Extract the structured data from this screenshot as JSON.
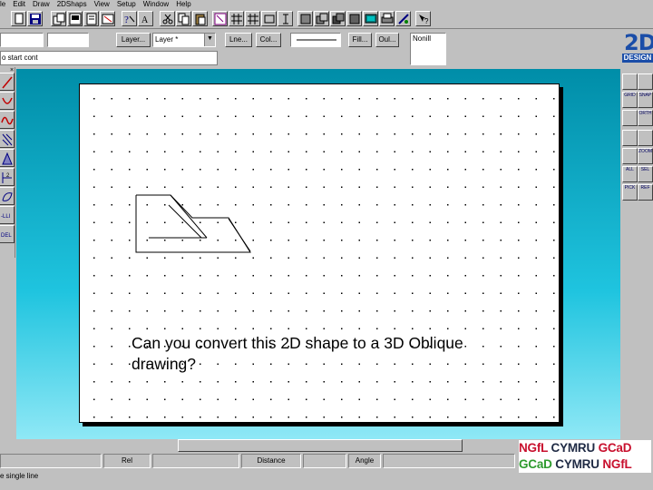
{
  "menubar": {
    "items": [
      "le",
      "Edit",
      "Draw",
      "2DShaps",
      "View",
      "Setup",
      "Window",
      "Help"
    ]
  },
  "toolbar1": {
    "icons": [
      "new-icon",
      "open-icon",
      "save-icon",
      "save-as-icon",
      "print-icon",
      "help-icon",
      "cut-icon",
      "copy-icon",
      "paste-icon",
      "undo-icon",
      "select-icon",
      "group-icon",
      "ungroup-icon",
      "align-icon",
      "layer-icon",
      "screen-icon",
      "printer-icon",
      "link-icon",
      "query-icon"
    ]
  },
  "toolbar2": {
    "field1_value": "",
    "field2_value": "",
    "layers_button": "Layer...",
    "layer_select": "Layer *",
    "line_button": "Lne...",
    "col_button": "Col...",
    "fill_button": "Fill...",
    "out_button": "Oul...",
    "style_text": "Nonill"
  },
  "logo": {
    "big": "2D",
    "small": "DESIGN"
  },
  "prompt": {
    "text": "o start cont"
  },
  "canvas": {
    "question": "Can you convert this 2D shape to a 3D Oblique drawing?"
  },
  "lefttools": {
    "close": "×",
    "items": [
      "line-tool-icon",
      "arc-tool-icon",
      "curve-tool-icon",
      "hatch-tool-icon",
      "oblique-tool-icon",
      "dim-tool-icon",
      "shape-tool-icon",
      "text-tool-icon",
      "delete-tool-icon"
    ],
    "labels": [
      "",
      "",
      "",
      "",
      "",
      "",
      "",
      "-LLI",
      "DEL"
    ]
  },
  "righttools": {
    "labels": [
      "GRID",
      "",
      "SNAP",
      "ORTH",
      "",
      "",
      "",
      "ZOOM",
      "ALL",
      "SEL",
      "SEL",
      "PICK",
      "",
      "REF"
    ]
  },
  "statusbar": {
    "rel": "Rel",
    "distance": "Distance",
    "angle": "Angle",
    "hint": "e single line"
  },
  "footer_logo": {
    "line1": [
      "NGfL",
      "CYMRU",
      "GCaD"
    ],
    "line2": [
      "GCaD",
      "CYMRU",
      "NGfL"
    ]
  }
}
